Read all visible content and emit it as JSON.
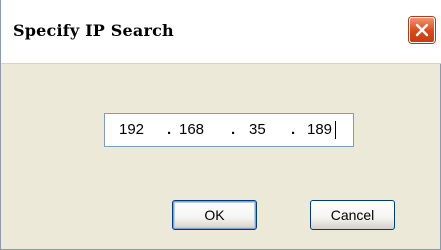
{
  "dialog": {
    "title": "Specify IP Search",
    "close_icon": "close-icon",
    "close_color": "#d8491c"
  },
  "ip_field": {
    "octet1": "192",
    "octet2": "168",
    "octet3": "35",
    "octet4": "189",
    "separator": "."
  },
  "buttons": {
    "ok_label": "OK",
    "cancel_label": "Cancel"
  }
}
